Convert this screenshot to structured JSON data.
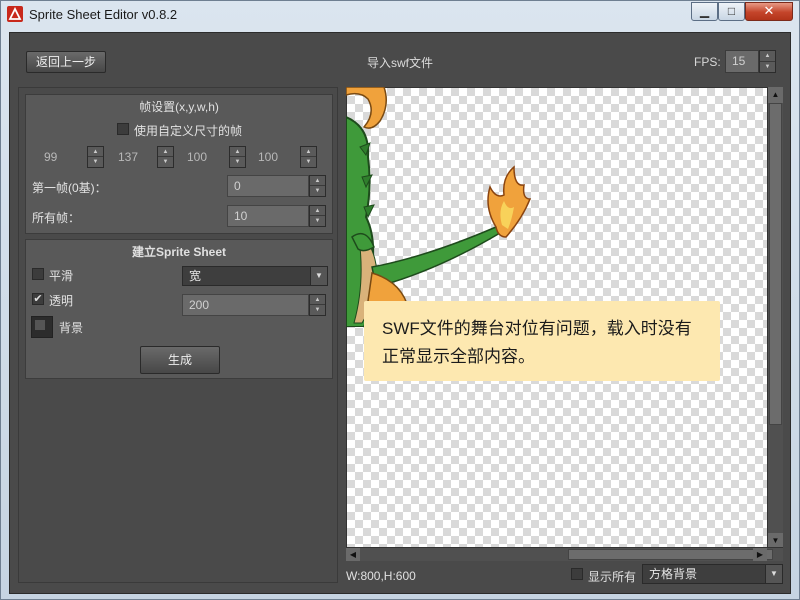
{
  "window": {
    "title": "Sprite Sheet Editor v0.8.2",
    "icon": "app-logo-red"
  },
  "toolbar": {
    "back_label": "返回上一步",
    "import_title": "导入swf文件",
    "fps_label": "FPS:",
    "fps_value": "15"
  },
  "frame_settings": {
    "title": "帧设置(x,y,w,h)",
    "custom_size_label": "使用自定义尺寸的帧",
    "custom_size_checked": false,
    "x": "99",
    "y": "137",
    "w": "100",
    "h": "100",
    "first_frame_label": "第一帧(0基)：",
    "first_frame_value": "0",
    "all_frames_label": "所有帧：",
    "all_frames_value": "10"
  },
  "sprite_sheet": {
    "title": "建立Sprite Sheet",
    "smooth_label": "平滑",
    "smooth_checked": false,
    "transparent_label": "透明",
    "transparent_checked": true,
    "background_label": "背景",
    "width_select_value": "宽",
    "width_value": "200",
    "generate_label": "生成"
  },
  "canvas": {
    "note_text": "SWF文件的舞台对位有问题，载入时没有正常显示全部内容。"
  },
  "status": {
    "size_text": "W:800,H:600",
    "show_all_label": "显示所有",
    "show_all_checked": false,
    "bg_select_value": "方格背景"
  },
  "colors": {
    "panel": "#4a4a4a",
    "group": "#595959",
    "note_bg": "#fde8b0",
    "dragon_green": "#3f9a3a",
    "dragon_orange": "#f0a23c"
  }
}
